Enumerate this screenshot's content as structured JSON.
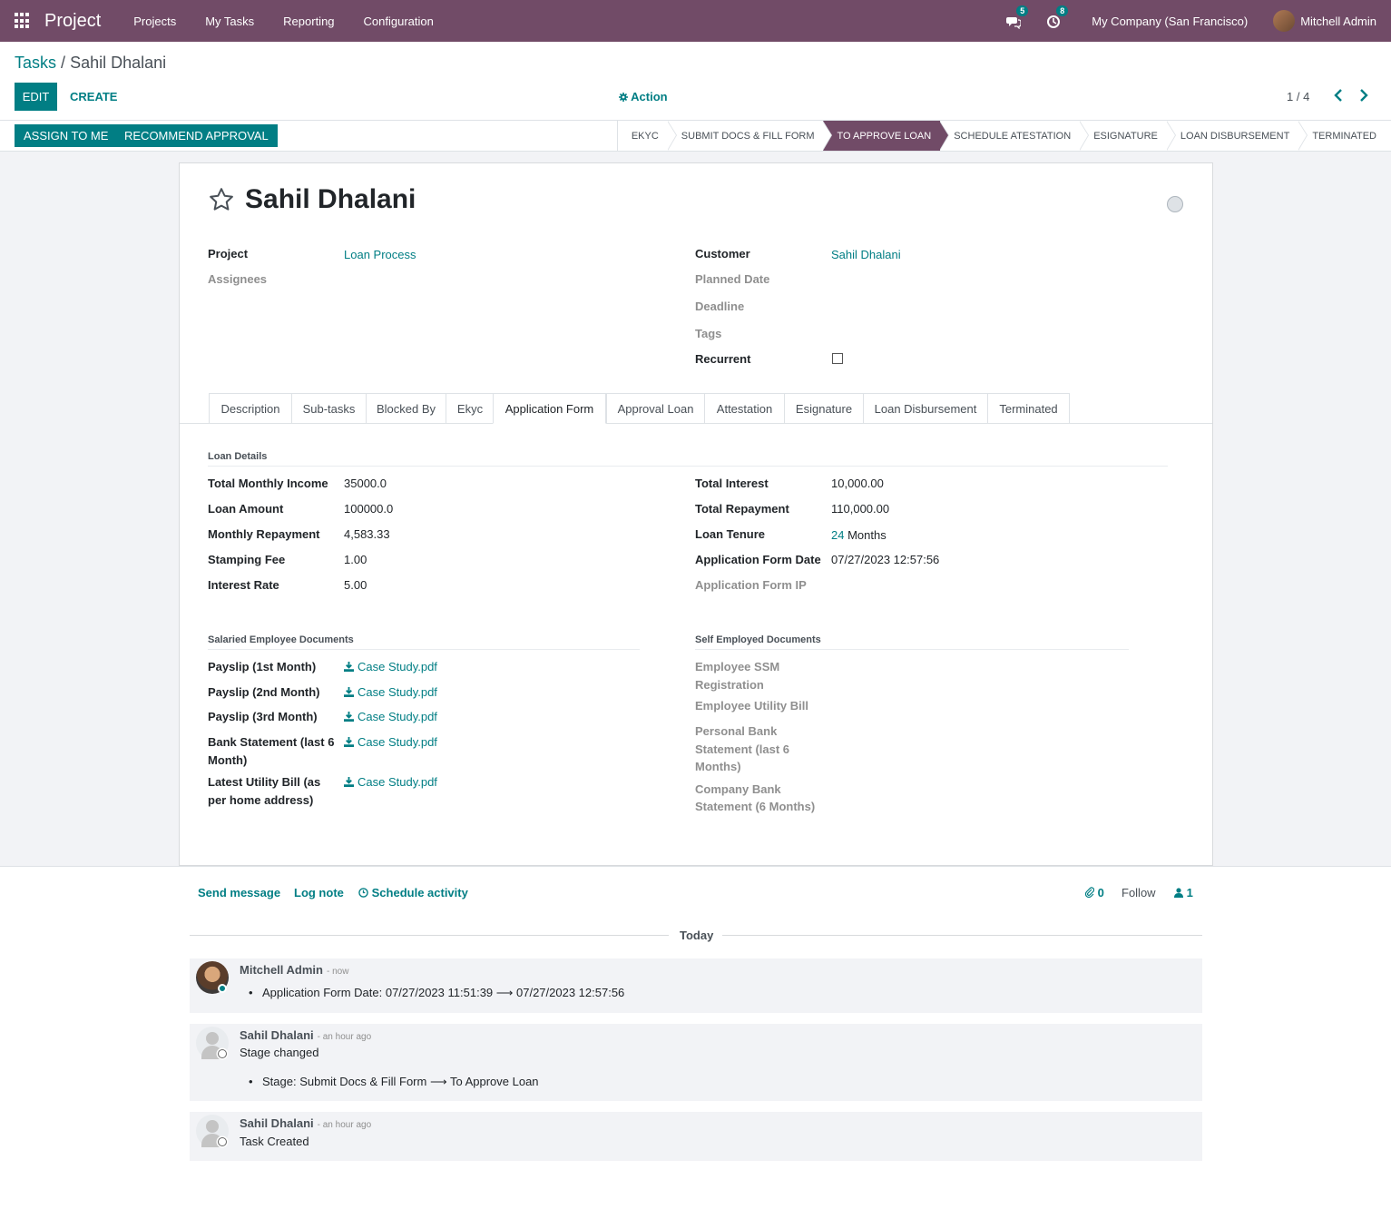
{
  "navbar": {
    "brand": "Project",
    "menu": [
      "Projects",
      "My Tasks",
      "Reporting",
      "Configuration"
    ],
    "messages_count": "5",
    "activities_count": "8",
    "company": "My Company (San Francisco)",
    "user": "Mitchell Admin"
  },
  "breadcrumb": {
    "parent": "Tasks",
    "separator": "/",
    "current": "Sahil Dhalani"
  },
  "buttons": {
    "edit": "EDIT",
    "create": "CREATE",
    "action": "Action",
    "assign": "ASSIGN TO ME",
    "recommend": "RECOMMEND APPROVAL"
  },
  "pager": {
    "value": "1 / 4"
  },
  "stages": [
    {
      "label": "EKYC",
      "active": false
    },
    {
      "label": "SUBMIT DOCS & FILL FORM",
      "active": false
    },
    {
      "label": "TO APPROVE LOAN",
      "active": true
    },
    {
      "label": "SCHEDULE ATESTATION",
      "active": false
    },
    {
      "label": "ESIGNATURE",
      "active": false
    },
    {
      "label": "LOAN DISBURSEMENT",
      "active": false
    },
    {
      "label": "TERMINATED",
      "active": false
    }
  ],
  "record": {
    "title": "Sahil Dhalani",
    "project_label": "Project",
    "project_value": "Loan Process",
    "assignees_label": "Assignees",
    "customer_label": "Customer",
    "customer_value": "Sahil Dhalani",
    "planned_date_label": "Planned Date",
    "deadline_label": "Deadline",
    "tags_label": "Tags",
    "recurrent_label": "Recurrent",
    "recurrent_checked": false
  },
  "tabs": [
    "Description",
    "Sub-tasks",
    "Blocked By",
    "Ekyc",
    "Application Form",
    "Approval Loan",
    "Attestation",
    "Esignature",
    "Loan Disbursement",
    "Terminated"
  ],
  "active_tab": "Application Form",
  "loan_details": {
    "title": "Loan Details",
    "left": [
      {
        "label": "Total Monthly Income",
        "value": "35000.0"
      },
      {
        "label": "Loan Amount",
        "value": "100000.0"
      },
      {
        "label": "Monthly Repayment",
        "value": "4,583.33"
      },
      {
        "label": "Stamping Fee",
        "value": "1.00"
      },
      {
        "label": "Interest Rate",
        "value": "5.00"
      }
    ],
    "right": [
      {
        "label": "Total Interest",
        "value": "10,000.00"
      },
      {
        "label": "Total Repayment",
        "value": "110,000.00"
      },
      {
        "label": "Loan Tenure",
        "value_num": "24",
        "value_unit": "Months"
      },
      {
        "label": "Application Form Date",
        "value": "07/27/2023 12:57:56"
      },
      {
        "label": "Application Form IP",
        "value": ""
      }
    ]
  },
  "salaried_docs": {
    "title": "Salaried Employee Documents",
    "items": [
      {
        "label_1": "Payslip (1st Month)",
        "label_2": "",
        "file": "Case Study.pdf"
      },
      {
        "label_1": "Payslip (2nd Month)",
        "label_2": "",
        "file": "Case Study.pdf"
      },
      {
        "label_1": "Payslip (3rd Month)",
        "label_2": "",
        "file": "Case Study.pdf"
      },
      {
        "label_1": "Bank Statement (last 6",
        "label_2": "Month)",
        "file": "Case Study.pdf"
      },
      {
        "label_1": "Latest Utility Bill (as",
        "label_2": "per home address)",
        "file": "Case Study.pdf"
      }
    ]
  },
  "self_employed_docs": {
    "title": "Self Employed Documents",
    "items": [
      {
        "lines": [
          "Employee SSM",
          "Registration"
        ]
      },
      {
        "lines": [
          "Employee Utility Bill"
        ]
      },
      {
        "lines": [
          "Personal Bank",
          "Statement (last 6",
          "Months)"
        ]
      },
      {
        "lines": [
          "Company Bank",
          "Statement (6 Months)"
        ]
      }
    ]
  },
  "chatter": {
    "send_message": "Send message",
    "log_note": "Log note",
    "schedule_activity": "Schedule activity",
    "attachments": "0",
    "follow": "Follow",
    "followers": "1",
    "date_separator": "Today",
    "messages": [
      {
        "author": "Mitchell Admin",
        "when": "- now",
        "text": "",
        "bullet": "Application Form Date: 07/27/2023 11:51:39 ⟶ 07/27/2023 12:57:56"
      },
      {
        "author": "Sahil Dhalani",
        "when": "- an hour ago",
        "text": "Stage changed",
        "bullet": "Stage: Submit Docs & Fill Form ⟶ To Approve Loan"
      },
      {
        "author": "Sahil Dhalani",
        "when": "- an hour ago",
        "text": "Task Created",
        "bullet": ""
      }
    ]
  },
  "colors": {
    "brand": "#714B67",
    "accent": "#017E84"
  }
}
